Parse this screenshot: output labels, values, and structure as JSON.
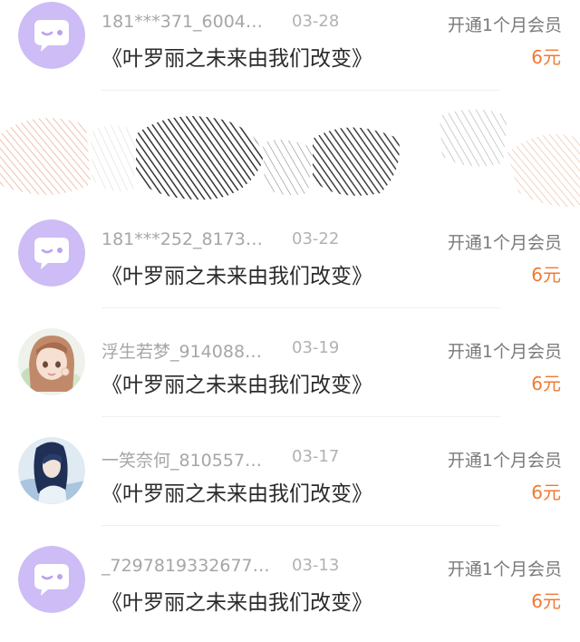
{
  "colors": {
    "default_avatar_bg": "#cdbcf5",
    "price": "#f07a32",
    "username": "#a6a6a6"
  },
  "records": [
    {
      "username": "181***371_6004…",
      "date": "03-28",
      "action": "开通1个月会员",
      "title": "《叶罗丽之未来由我们改变》",
      "price": "6元",
      "avatar": "default-chat-bubble-avatar"
    },
    {
      "username": "181***252_8173…",
      "date": "03-22",
      "action": "开通1个月会员",
      "title": "《叶罗丽之未来由我们改变》",
      "price": "6元",
      "avatar": "default-chat-bubble-avatar"
    },
    {
      "username": "浮生若梦_914088…",
      "date": "03-19",
      "action": "开通1个月会员",
      "title": "《叶罗丽之未来由我们改变》",
      "price": "6元",
      "avatar": "anime-girl-photo-avatar"
    },
    {
      "username": "一笑奈何_810557…",
      "date": "03-17",
      "action": "开通1个月会员",
      "title": "《叶罗丽之未来由我们改变》",
      "price": "6元",
      "avatar": "blue-hair-character-photo-avatar"
    },
    {
      "username": "_7297819332677…",
      "date": "03-13",
      "action": "开通1个月会员",
      "title": "《叶罗丽之未来由我们改变》",
      "price": "6元",
      "avatar": "default-chat-bubble-avatar"
    }
  ]
}
